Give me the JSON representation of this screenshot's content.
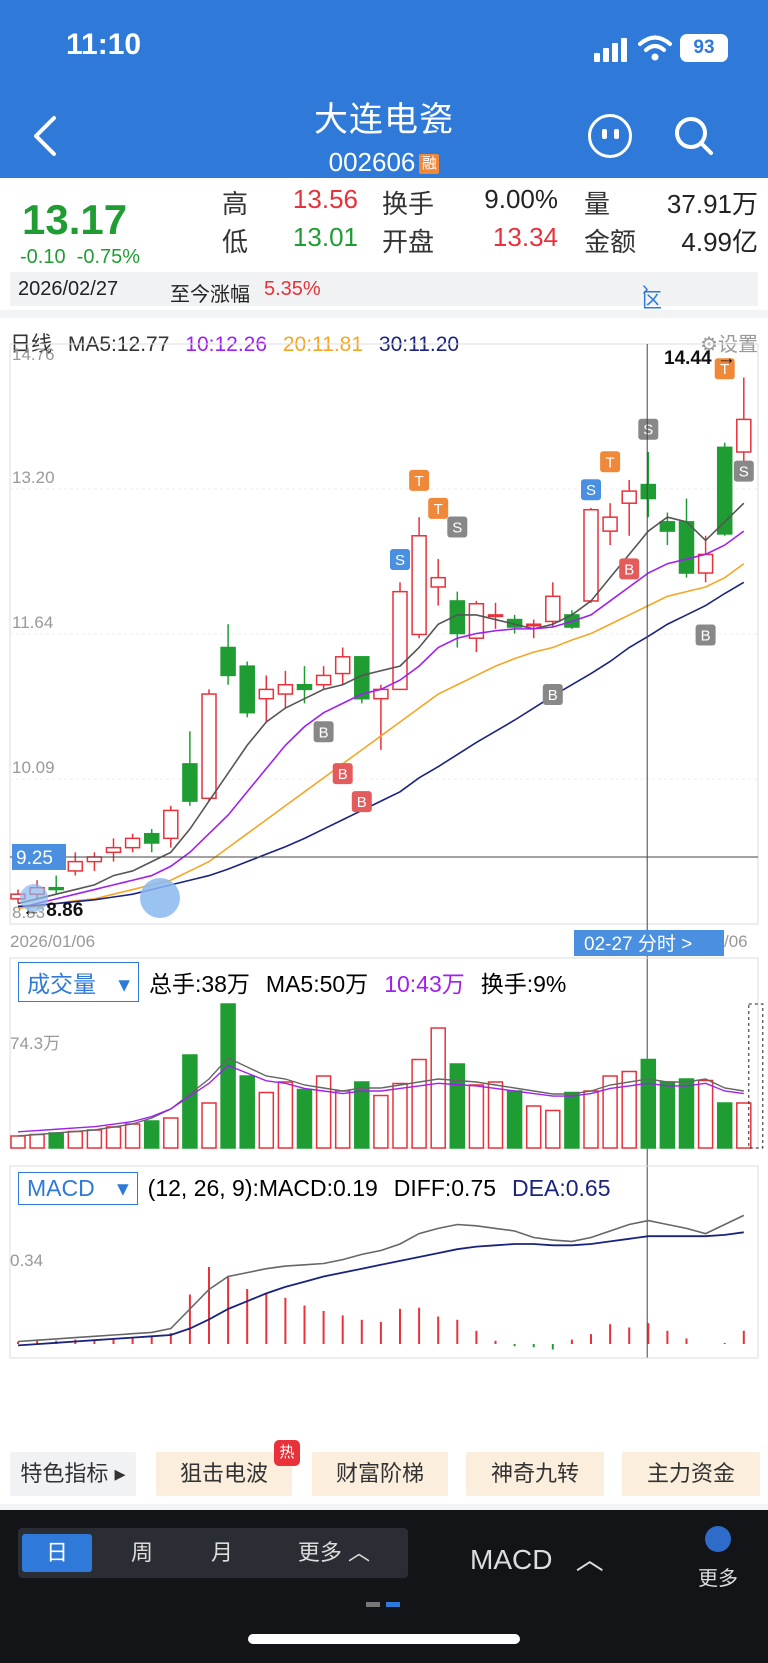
{
  "status": {
    "time": "11:10",
    "battery": "93"
  },
  "header": {
    "stock_name": "大连电瓷",
    "stock_code": "002606",
    "tag": "融"
  },
  "quote": {
    "price": "13.17",
    "change": "-0.10",
    "change_pct": "-0.75%",
    "high_label": "高",
    "high": "13.56",
    "low_label": "低",
    "low": "13.01",
    "turnover_label": "换手",
    "turnover": "9.00%",
    "open_label": "开盘",
    "open": "13.34",
    "volume_label": "量",
    "volume": "37.91万",
    "amount_label": "金额",
    "amount": "4.99亿",
    "date": "2026/02/27",
    "since_label": "至今涨幅",
    "since_value": "5.35%",
    "range_stat": "区间统计"
  },
  "ma": {
    "label": "日线",
    "ma5": "MA5:12.77",
    "ma10": "10:12.26",
    "ma20": "20:11.81",
    "ma30": "30:11.20",
    "settings": "设置"
  },
  "colors": {
    "up": "#e8313a",
    "down": "#1f9d33",
    "ma5": "#555555",
    "ma10": "#a020f0",
    "ma20": "#f5a623",
    "ma30": "#1a237e",
    "accent": "#2f7ad9"
  },
  "main_chart": {
    "y_ticks": [
      "14.76",
      "13.20",
      "11.64",
      "10.09",
      "8.53"
    ],
    "crosshair_price": "9.25",
    "max_label": "14.44",
    "min_label": "8.86",
    "start_date": "2026/01/06",
    "end_date_partial": "/06",
    "crosshair_tip": "02-27 分时 >",
    "signal_labels": {
      "t": "T",
      "s": "S",
      "b": "B"
    }
  },
  "chart_data": [
    {
      "type": "candlestick",
      "ylim": [
        8.53,
        14.76
      ],
      "y_ticks": [
        "14.76",
        "13.20",
        "11.64",
        "10.09",
        "8.53"
      ],
      "candles": [
        {
          "o": 8.8,
          "c": 8.85,
          "h": 8.9,
          "l": 8.75
        },
        {
          "o": 8.85,
          "c": 8.92,
          "h": 9.0,
          "l": 8.8
        },
        {
          "o": 8.92,
          "c": 8.9,
          "h": 9.05,
          "l": 8.85
        },
        {
          "o": 9.1,
          "c": 9.2,
          "h": 9.3,
          "l": 9.05
        },
        {
          "o": 9.2,
          "c": 9.25,
          "h": 9.3,
          "l": 9.1
        },
        {
          "o": 9.3,
          "c": 9.35,
          "h": 9.45,
          "l": 9.2
        },
        {
          "o": 9.35,
          "c": 9.45,
          "h": 9.5,
          "l": 9.3
        },
        {
          "o": 9.5,
          "c": 9.4,
          "h": 9.55,
          "l": 9.3
        },
        {
          "o": 9.45,
          "c": 9.75,
          "h": 9.8,
          "l": 9.35
        },
        {
          "o": 10.25,
          "c": 9.85,
          "h": 10.6,
          "l": 9.8
        },
        {
          "o": 9.88,
          "c": 11.0,
          "h": 11.05,
          "l": 9.85
        },
        {
          "o": 11.5,
          "c": 11.2,
          "h": 11.75,
          "l": 11.1
        },
        {
          "o": 11.3,
          "c": 10.8,
          "h": 11.35,
          "l": 10.75
        },
        {
          "o": 10.95,
          "c": 11.05,
          "h": 11.2,
          "l": 10.7
        },
        {
          "o": 11.0,
          "c": 11.1,
          "h": 11.25,
          "l": 10.85
        },
        {
          "o": 11.1,
          "c": 11.05,
          "h": 11.3,
          "l": 10.9
        },
        {
          "o": 11.1,
          "c": 11.2,
          "h": 11.3,
          "l": 11.05
        },
        {
          "o": 11.22,
          "c": 11.4,
          "h": 11.5,
          "l": 11.1
        },
        {
          "o": 11.4,
          "c": 10.95,
          "h": 11.4,
          "l": 10.9
        },
        {
          "o": 10.95,
          "c": 11.05,
          "h": 11.1,
          "l": 10.4
        },
        {
          "o": 11.05,
          "c": 12.1,
          "h": 12.2,
          "l": 11.05
        },
        {
          "o": 11.64,
          "c": 12.7,
          "h": 12.9,
          "l": 11.6
        },
        {
          "o": 12.15,
          "c": 12.25,
          "h": 12.45,
          "l": 11.95
        },
        {
          "o": 12.0,
          "c": 11.65,
          "h": 12.1,
          "l": 11.5
        },
        {
          "o": 11.6,
          "c": 11.97,
          "h": 12.0,
          "l": 11.45
        },
        {
          "o": 11.85,
          "c": 11.85,
          "h": 11.98,
          "l": 11.7
        },
        {
          "o": 11.8,
          "c": 11.72,
          "h": 11.85,
          "l": 11.65
        },
        {
          "o": 11.75,
          "c": 11.75,
          "h": 11.8,
          "l": 11.6
        },
        {
          "o": 11.78,
          "c": 12.05,
          "h": 12.2,
          "l": 11.72
        },
        {
          "o": 11.85,
          "c": 11.72,
          "h": 11.9,
          "l": 11.7
        },
        {
          "o": 12.0,
          "c": 12.98,
          "h": 13.0,
          "l": 11.98
        },
        {
          "o": 12.75,
          "c": 12.9,
          "h": 13.05,
          "l": 12.6
        },
        {
          "o": 13.05,
          "c": 13.18,
          "h": 13.3,
          "l": 12.7
        },
        {
          "o": 13.25,
          "c": 13.1,
          "h": 13.6,
          "l": 12.9
        },
        {
          "o": 12.85,
          "c": 12.75,
          "h": 12.95,
          "l": 12.6
        },
        {
          "o": 12.85,
          "c": 12.3,
          "h": 13.1,
          "l": 12.25
        },
        {
          "o": 12.3,
          "c": 12.5,
          "h": 12.7,
          "l": 12.2
        },
        {
          "o": 13.65,
          "c": 12.72,
          "h": 13.7,
          "l": 12.7
        },
        {
          "o": 13.6,
          "c": 13.95,
          "h": 14.4,
          "l": 13.5
        }
      ],
      "ma": {
        "ma5": [
          8.75,
          8.8,
          8.85,
          8.9,
          8.95,
          9.05,
          9.1,
          9.2,
          9.3,
          9.55,
          9.85,
          10.15,
          10.45,
          10.7,
          10.85,
          10.95,
          11.05,
          11.1,
          11.2,
          11.25,
          11.3,
          11.5,
          11.75,
          11.85,
          11.85,
          11.8,
          11.75,
          11.7,
          11.75,
          11.85,
          12.0,
          12.25,
          12.5,
          12.75,
          12.9,
          12.85,
          12.65,
          12.85,
          13.05
        ],
        "ma10": [
          8.7,
          8.75,
          8.8,
          8.85,
          8.9,
          8.95,
          9.0,
          9.05,
          9.15,
          9.3,
          9.5,
          9.7,
          9.95,
          10.2,
          10.45,
          10.65,
          10.8,
          10.9,
          11.0,
          11.05,
          11.15,
          11.3,
          11.5,
          11.6,
          11.65,
          11.68,
          11.7,
          11.7,
          11.72,
          11.78,
          11.85,
          12.0,
          12.15,
          12.3,
          12.4,
          12.45,
          12.5,
          12.6,
          12.75
        ],
        "ma20": [
          8.7,
          8.72,
          8.75,
          8.78,
          8.8,
          8.85,
          8.9,
          8.95,
          9.0,
          9.1,
          9.2,
          9.35,
          9.5,
          9.65,
          9.8,
          9.95,
          10.1,
          10.25,
          10.4,
          10.55,
          10.7,
          10.85,
          11.0,
          11.1,
          11.2,
          11.3,
          11.38,
          11.45,
          11.5,
          11.58,
          11.65,
          11.75,
          11.85,
          11.95,
          12.05,
          12.1,
          12.15,
          12.25,
          12.4
        ],
        "ma30": [
          8.72,
          8.73,
          8.75,
          8.77,
          8.79,
          8.82,
          8.85,
          8.9,
          8.95,
          9.0,
          9.05,
          9.12,
          9.2,
          9.28,
          9.36,
          9.45,
          9.55,
          9.65,
          9.75,
          9.85,
          9.95,
          10.1,
          10.22,
          10.35,
          10.48,
          10.6,
          10.72,
          10.85,
          10.98,
          11.1,
          11.22,
          11.35,
          11.5,
          11.62,
          11.75,
          11.85,
          11.95,
          12.08,
          12.2
        ]
      }
    },
    {
      "type": "bar",
      "title": "成交量",
      "y_tick": "74.3万",
      "values": [
        8,
        9,
        10,
        11,
        12,
        14,
        16,
        18,
        20,
        62,
        30,
        96,
        48,
        37,
        44,
        39,
        48,
        38,
        44,
        35,
        43,
        59,
        80,
        56,
        42,
        44,
        38,
        28,
        25,
        37,
        38,
        48,
        51,
        59,
        44,
        46,
        45,
        30,
        30,
        48,
        56
      ],
      "ma5": [
        8,
        9,
        10,
        11,
        12,
        14,
        16,
        20,
        26,
        36,
        46,
        60,
        54,
        48,
        46,
        42,
        40,
        38,
        40,
        40,
        42,
        44,
        46,
        45,
        44,
        42,
        40,
        38,
        36,
        36,
        38,
        42,
        44,
        46,
        44,
        44,
        46,
        40,
        38,
        40,
        44
      ]
    },
    {
      "type": "bar",
      "title": "MACD",
      "y_tick": "0.34",
      "macd": [
        0.02,
        0.03,
        0.03,
        0.04,
        0.04,
        0.05,
        0.06,
        0.07,
        0.1,
        0.45,
        0.7,
        0.62,
        0.5,
        0.46,
        0.42,
        0.35,
        0.3,
        0.26,
        0.22,
        0.2,
        0.32,
        0.33,
        0.25,
        0.22,
        0.12,
        0.03,
        -0.02,
        -0.03,
        -0.05,
        0.04,
        0.09,
        0.18,
        0.15,
        0.19,
        0.12,
        0.05,
        0.0,
        0.01,
        0.12,
        0.19
      ],
      "diff": [
        0.05,
        0.06,
        0.07,
        0.08,
        0.09,
        0.1,
        0.11,
        0.12,
        0.15,
        0.3,
        0.45,
        0.55,
        0.58,
        0.61,
        0.63,
        0.64,
        0.65,
        0.68,
        0.72,
        0.75,
        0.8,
        0.88,
        0.92,
        0.95,
        0.94,
        0.92,
        0.9,
        0.85,
        0.83,
        0.82,
        0.85,
        0.9,
        0.95,
        0.98,
        0.95,
        0.92,
        0.88,
        0.95,
        1.02
      ],
      "dea": [
        0.02,
        0.03,
        0.04,
        0.05,
        0.06,
        0.07,
        0.08,
        0.09,
        0.1,
        0.15,
        0.22,
        0.3,
        0.36,
        0.42,
        0.47,
        0.51,
        0.55,
        0.58,
        0.61,
        0.64,
        0.67,
        0.7,
        0.73,
        0.76,
        0.78,
        0.79,
        0.8,
        0.8,
        0.79,
        0.79,
        0.8,
        0.82,
        0.84,
        0.86,
        0.86,
        0.86,
        0.86,
        0.87,
        0.89
      ]
    }
  ],
  "volume_panel": {
    "selector": "成交量",
    "total": "总手:38万",
    "ma5": "MA5:50万",
    "ma10": "10:43万",
    "turnover": "换手:9%"
  },
  "macd_panel": {
    "selector": "MACD",
    "params": "(12, 26, 9):MACD:0.19",
    "diff": "DIFF:0.75",
    "dea": "DEA:0.65"
  },
  "features": {
    "special": "特色指标",
    "f1": "狙击电波",
    "hot": "热",
    "f2": "财富阶梯",
    "f3": "神奇九转",
    "f4": "主力资金"
  },
  "bottom": {
    "day": "日",
    "week": "周",
    "month": "月",
    "more_period": "更多",
    "indicator": "MACD",
    "more": "更多"
  }
}
